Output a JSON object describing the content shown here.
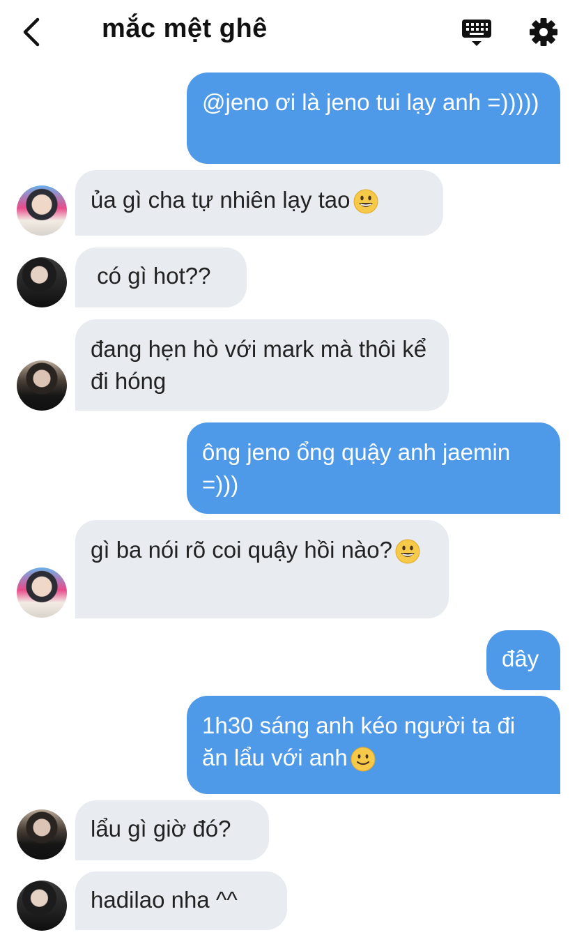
{
  "header": {
    "title": "mắc mệt ghê"
  },
  "icons": {
    "back": "chevron-left-icon",
    "keyboard": "keyboard-icon",
    "settings": "gear-icon"
  },
  "colors": {
    "outgoing": "#4f9ae8",
    "incoming": "#e8ecf0"
  },
  "messages": [
    {
      "side": "out",
      "text": "@jeno ơi là jeno tui lạy anh =)))))"
    },
    {
      "side": "in",
      "text": "ủa gì cha tự nhiên lạy tao",
      "emoji": "grinning"
    },
    {
      "side": "in",
      "text": " có gì hot??"
    },
    {
      "side": "in",
      "text": "đang hẹn hò với mark mà thôi kể đi hóng"
    },
    {
      "side": "out",
      "text": "ông jeno ổng quậy anh jaemin =)))"
    },
    {
      "side": "in",
      "text": "gì ba nói rõ coi quậy hồi nào?",
      "emoji": "grinning"
    },
    {
      "side": "out",
      "text": "đây"
    },
    {
      "side": "out",
      "text": "1h30 sáng anh kéo người ta đi ăn lẩu với anh",
      "emoji": "slight-smile"
    },
    {
      "side": "in",
      "text": "lẩu gì giờ đó?"
    },
    {
      "side": "in",
      "text": "hadilao nha ^^"
    }
  ]
}
